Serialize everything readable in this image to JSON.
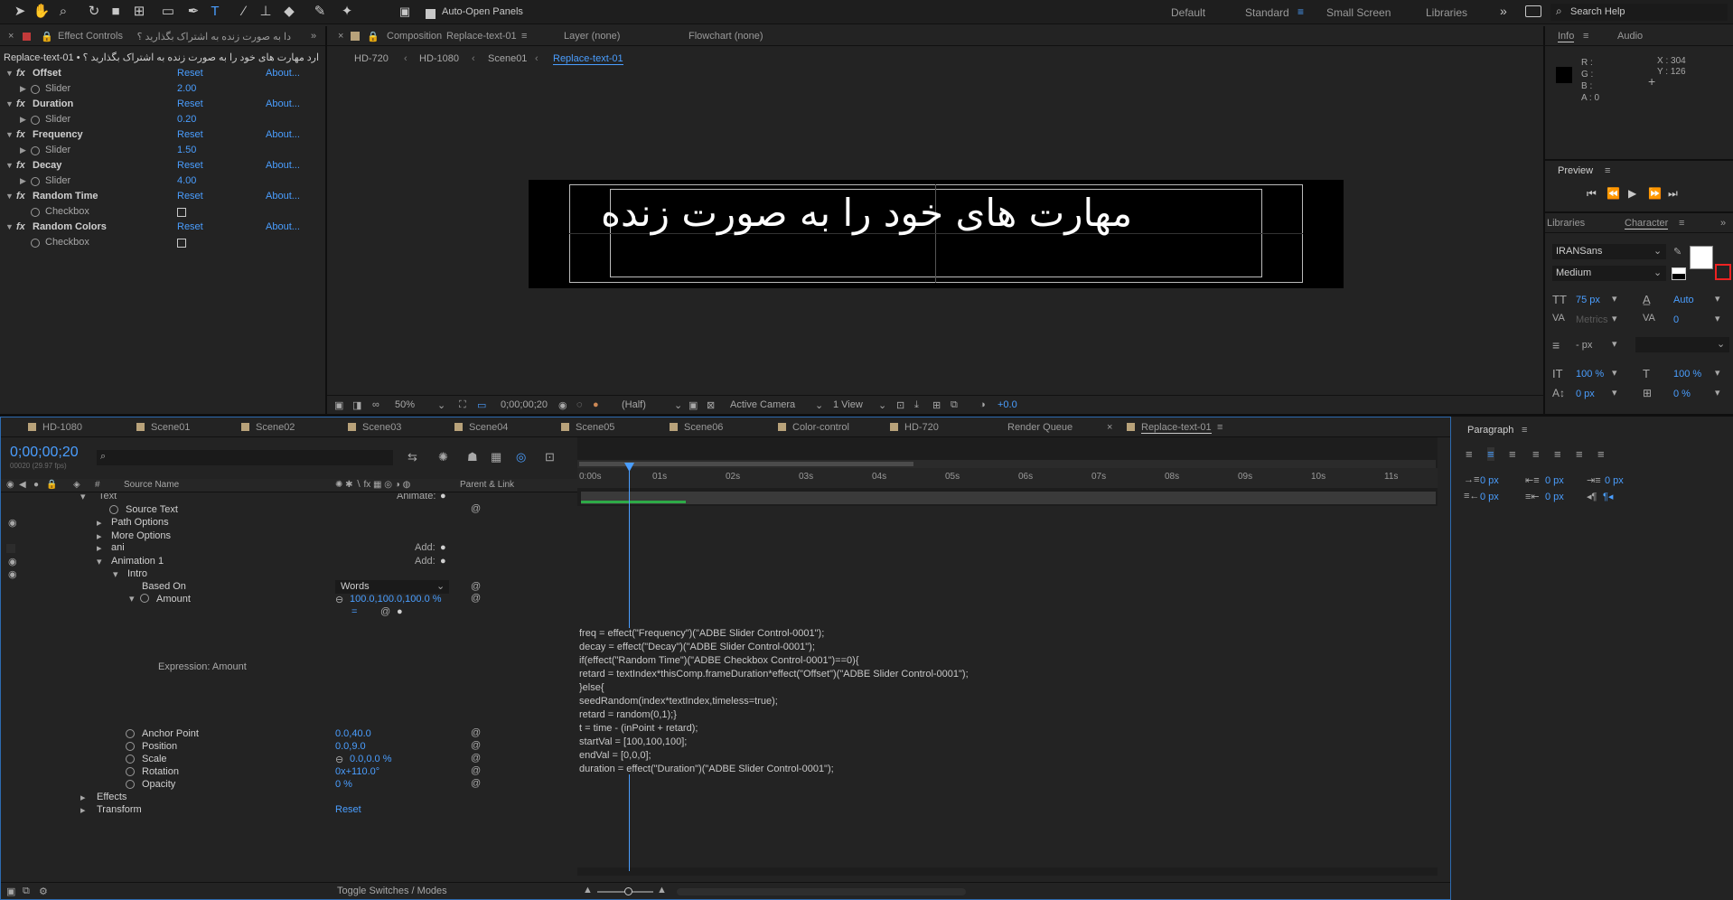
{
  "toolbar": {
    "auto_open_label": "Auto-Open Panels",
    "workspaces": [
      "Default",
      "Standard",
      "Small Screen",
      "Libraries"
    ],
    "search_placeholder": "Search Help"
  },
  "effect_controls": {
    "tab_label": "Effect Controls",
    "tab_layer": "دا به صورت زنده به اشتراک بگذارید ؟",
    "breadcrumb": "Replace-text-01 • ارد مهارت های خود را به صورت زنده به اشتراک بگذارید ؟",
    "effects": [
      {
        "name": "Offset",
        "reset": "Reset",
        "about": "About...",
        "control": "Slider",
        "value": "2.00",
        "type": "slider"
      },
      {
        "name": "Duration",
        "reset": "Reset",
        "about": "About...",
        "control": "Slider",
        "value": "0.20",
        "type": "slider"
      },
      {
        "name": "Frequency",
        "reset": "Reset",
        "about": "About...",
        "control": "Slider",
        "value": "1.50",
        "type": "slider"
      },
      {
        "name": "Decay",
        "reset": "Reset",
        "about": "About...",
        "control": "Slider",
        "value": "4.00",
        "type": "slider"
      },
      {
        "name": "Random Time",
        "reset": "Reset",
        "about": "About...",
        "control": "Checkbox",
        "value": "",
        "type": "checkbox"
      },
      {
        "name": "Random Colors",
        "reset": "Reset",
        "about": "About...",
        "control": "Checkbox",
        "value": "",
        "type": "checkbox"
      }
    ]
  },
  "composition": {
    "tab_prefix": "Composition",
    "tab_name": "Replace-text-01",
    "layer_tab": "Layer (none)",
    "flowchart_tab": "Flowchart (none)",
    "nav": [
      "HD-720",
      "HD-1080",
      "Scene01",
      "Replace-text-01"
    ],
    "canvas_text": "مهارت های خود را به صورت زنده",
    "zoom": "50%",
    "timecode": "0;00;00;20",
    "resolution": "(Half)",
    "camera": "Active Camera",
    "views": "1 View",
    "exposure": "+0.0"
  },
  "info": {
    "tab_info": "Info",
    "tab_audio": "Audio",
    "r": "R :",
    "g": "G :",
    "b": "B :",
    "a": "A : 0",
    "x": "X : 304",
    "y": "Y : 126"
  },
  "preview": {
    "title": "Preview"
  },
  "character": {
    "tab_libraries": "Libraries",
    "tab_character": "Character",
    "font": "IRANSans",
    "style": "Medium",
    "size": "75 px",
    "leading": "Auto",
    "kerning": "Metrics",
    "tracking": "0",
    "stroke": "- px",
    "vscale": "100 %",
    "hscale": "100 %",
    "baseline": "0 px",
    "tsume": "0 %"
  },
  "paragraph": {
    "title": "Paragraph",
    "indent_left": "0 px",
    "indent_right": "0 px",
    "indent_first": "0 px",
    "space_before": "0 px",
    "space_after": "0 px"
  },
  "timeline": {
    "tabs": [
      "HD-1080",
      "Scene01",
      "Scene02",
      "Scene03",
      "Scene04",
      "Scene05",
      "Scene06",
      "Color-control",
      "HD-720",
      "Render Queue",
      "Replace-text-01"
    ],
    "timecode": "0;00;00;20",
    "timecode_sub": "00020 (29.97 fps)",
    "col_source": "Source Name",
    "col_parent": "Parent & Link",
    "ruler": [
      "0:00s",
      "01s",
      "02s",
      "03s",
      "04s",
      "05s",
      "06s",
      "07s",
      "08s",
      "09s",
      "10s",
      "11s"
    ],
    "layers": {
      "text": "Text",
      "animate": "Animate:",
      "source_text": "Source Text",
      "path_options": "Path Options",
      "more_options": "More Options",
      "ani": "ani",
      "add": "Add:",
      "animation1": "Animation 1",
      "intro": "Intro",
      "based_on": "Based On",
      "based_on_value": "Words",
      "amount": "Amount",
      "amount_value": "100.0,100.0,100.0 %",
      "expression_label": "Expression: Amount",
      "anchor_point": "Anchor Point",
      "anchor_value": "0.0,40.0",
      "position": "Position",
      "position_value": "0.0,9.0",
      "scale": "Scale",
      "scale_value": "0.0,0.0 %",
      "rotation": "Rotation",
      "rotation_value": "0x+110.0°",
      "opacity": "Opacity",
      "opacity_value": "0 %",
      "effects": "Effects",
      "transform": "Transform",
      "reset": "Reset"
    },
    "expression_lines": [
      "freq = effect(\"Frequency\")(\"ADBE Slider Control-0001\");",
      "decay = effect(\"Decay\")(\"ADBE Slider Control-0001\");",
      "if(effect(\"Random Time\")(\"ADBE Checkbox Control-0001\")==0){",
      "retard = textIndex*thisComp.frameDuration*effect(\"Offset\")(\"ADBE Slider Control-0001\");",
      "}else{",
      "seedRandom(index*textIndex,timeless=true);",
      "retard = random(0,1);}",
      "t = time - (inPoint + retard);",
      "startVal = [100,100,100];",
      "endVal = [0,0,0];",
      "duration = effect(\"Duration\")(\"ADBE Slider Control-0001\");"
    ],
    "toggle_label": "Toggle Switches / Modes"
  }
}
